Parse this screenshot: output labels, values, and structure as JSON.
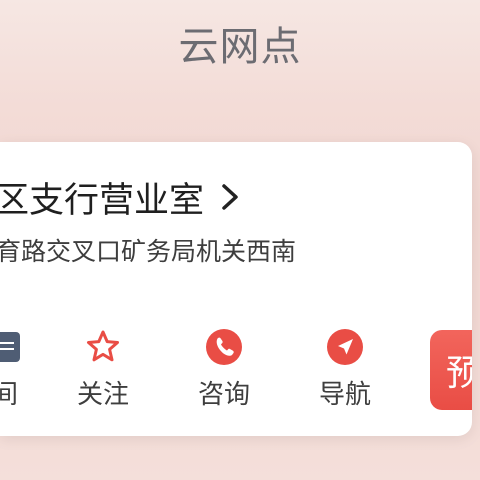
{
  "header": {
    "title": "云网点"
  },
  "branch": {
    "name": "区支行营业室",
    "address": "育路交叉口矿务局机关西南"
  },
  "actions": {
    "time": {
      "label": "间",
      "icon": "clock-icon"
    },
    "follow": {
      "label": "关注",
      "icon": "star-outline-icon"
    },
    "consult": {
      "label": "咨询",
      "icon": "phone-icon"
    },
    "navigate": {
      "label": "导航",
      "icon": "navigation-arrow-icon"
    },
    "appointment": {
      "label": "预"
    }
  },
  "colors": {
    "accent": "#e94d45",
    "icon_dark": "#4f5d74",
    "text": "#3e3e3e"
  }
}
